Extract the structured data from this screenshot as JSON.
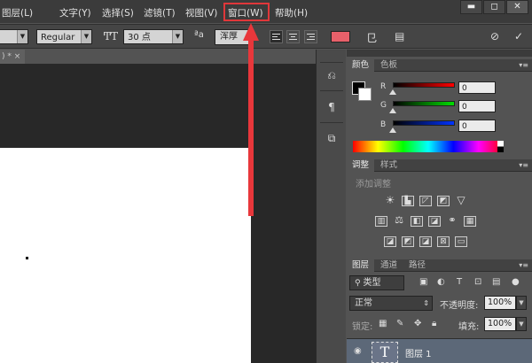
{
  "menu": [
    "图层(L)",
    "文字(Y)",
    "选择(S)",
    "滤镜(T)",
    "视图(V)",
    "窗口(W)",
    "帮助(H)"
  ],
  "window_controls": {
    "minimize": "▬",
    "maximize": "◻",
    "close": "✕"
  },
  "options": {
    "font_style": "Regular",
    "font_size": "30 点",
    "anti_alias_icon": "ªa",
    "anti_alias": "浑厚"
  },
  "doc_tab": ") * ×",
  "panels": {
    "color_tabs": [
      "颜色",
      "色板"
    ],
    "rgb": [
      {
        "label": "R",
        "value": "0"
      },
      {
        "label": "G",
        "value": "0"
      },
      {
        "label": "B",
        "value": "0"
      }
    ],
    "adjust_tabs": [
      "调整",
      "样式"
    ],
    "adjust_title": "添加调整",
    "layers_tabs": [
      "图层",
      "通道",
      "路径"
    ],
    "kind_filter": "类型",
    "blend_mode": "正常",
    "opacity_label": "不透明度:",
    "opacity_value": "100%",
    "lock_label": "锁定:",
    "fill_label": "填充:",
    "fill_value": "100%",
    "layer_name": "图层 1",
    "layer_thumb": "T"
  },
  "colors": {
    "highlight": "#e0373a",
    "menubar": "#3b3b3b",
    "panel": "#535353",
    "layer_selected": "#5c6878"
  }
}
